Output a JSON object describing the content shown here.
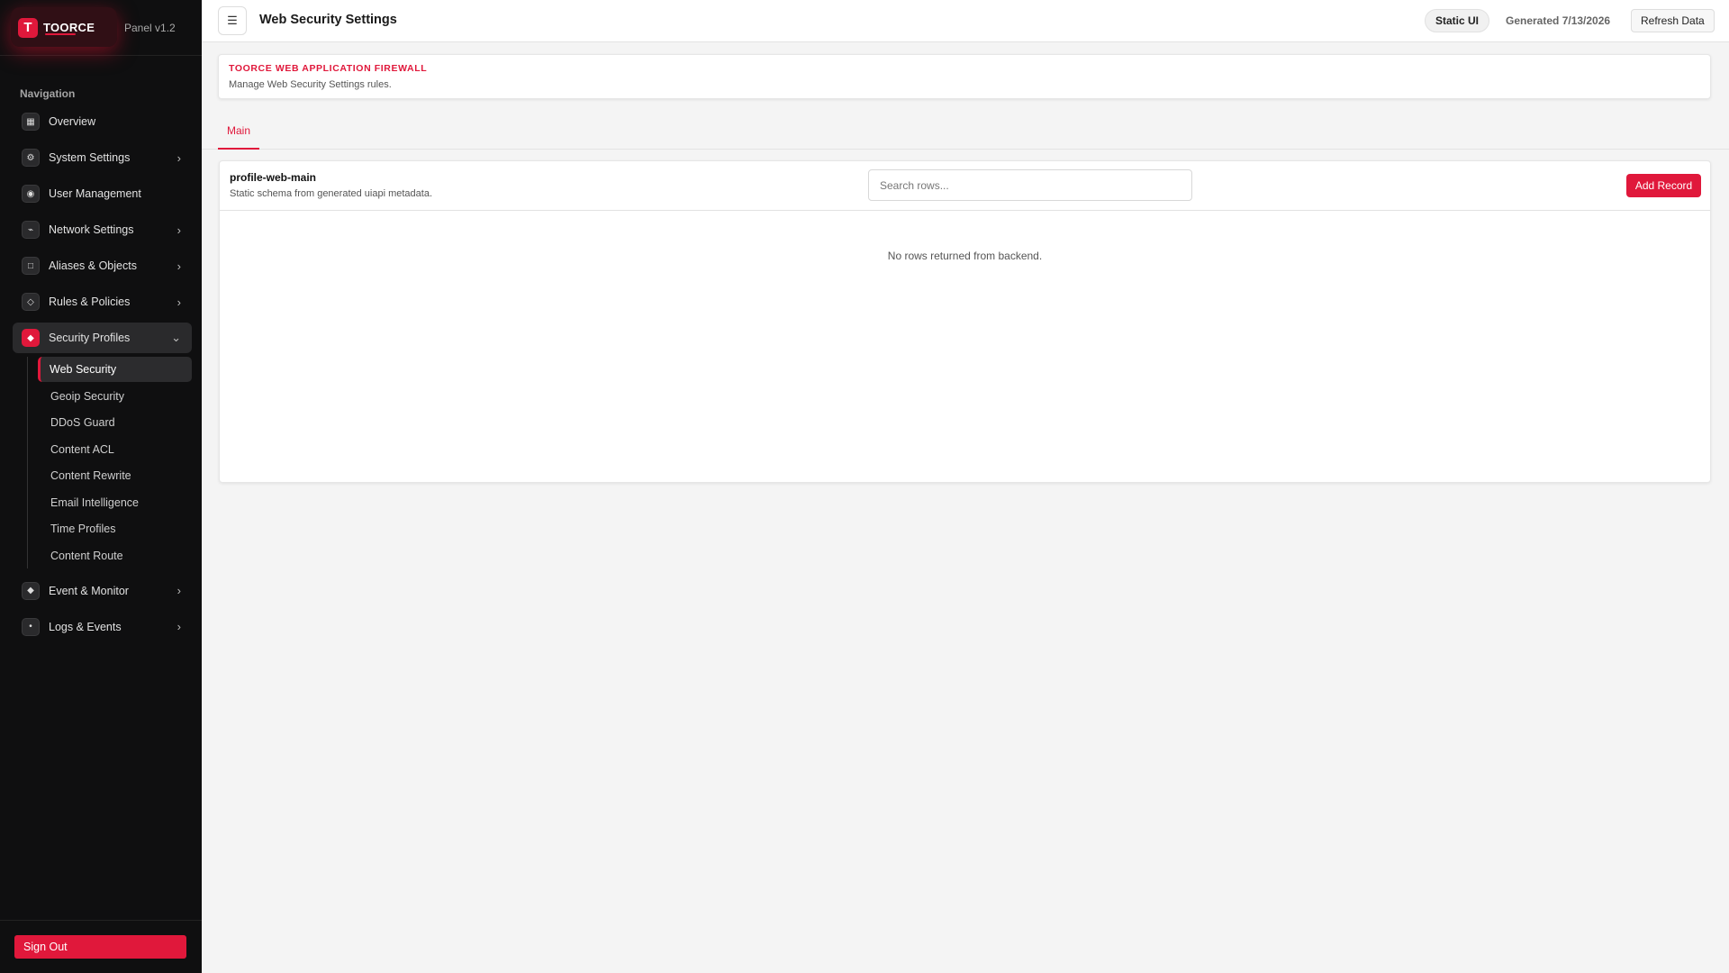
{
  "brand": {
    "logo_letter": "T",
    "name": "TOORCE",
    "version": "Panel v1.2"
  },
  "nav": {
    "heading": "Navigation",
    "items": [
      {
        "label": "Overview",
        "icon": "grid-icon",
        "glyph": "▦",
        "chevron": false
      },
      {
        "label": "System Settings",
        "icon": "gear-icon",
        "glyph": "⚙",
        "chevron": true
      },
      {
        "label": "User Management",
        "icon": "user-icon",
        "glyph": "◉",
        "chevron": false
      },
      {
        "label": "Network Settings",
        "icon": "network-icon",
        "glyph": "⌁",
        "chevron": true
      },
      {
        "label": "Aliases & Objects",
        "icon": "square-icon",
        "glyph": "□",
        "chevron": true
      },
      {
        "label": "Rules & Policies",
        "icon": "diamond-outline-icon",
        "glyph": "◇",
        "chevron": true
      },
      {
        "label": "Security Profiles",
        "icon": "shield-icon",
        "glyph": "◆",
        "chevron": true,
        "active": true
      },
      {
        "label": "Event & Monitor",
        "icon": "diamond-icon",
        "glyph": "◆",
        "chevron": true
      },
      {
        "label": "Logs & Events",
        "icon": "dot-icon",
        "glyph": "•",
        "chevron": true
      }
    ],
    "chevron_right": "›",
    "chevron_down": "⌄",
    "security_sub": [
      "Web Security",
      "Geoip Security",
      "DDoS Guard",
      "Content ACL",
      "Content Rewrite",
      "Email Intelligence",
      "Time Profiles",
      "Content Route"
    ],
    "security_sub_active": "Web Security"
  },
  "sign_out": "Sign Out",
  "topbar": {
    "menu_glyph": "☰",
    "title": "Web Security Settings",
    "badge": "Static UI",
    "generated": "Generated 7/13/2026",
    "refresh": "Refresh Data"
  },
  "header": {
    "kicker": "TOORCE WEB APPLICATION FIREWALL",
    "description": "Manage Web Security Settings rules."
  },
  "tabs": [
    "Main"
  ],
  "table": {
    "name": "profile-web-main",
    "description": "Static schema from generated uiapi metadata.",
    "search_placeholder": "Search rows...",
    "add_label": "Add Record",
    "empty_message": "No rows returned from backend."
  },
  "colors": {
    "accent": "#e0183b",
    "sidebar_bg": "#0f0f10"
  }
}
